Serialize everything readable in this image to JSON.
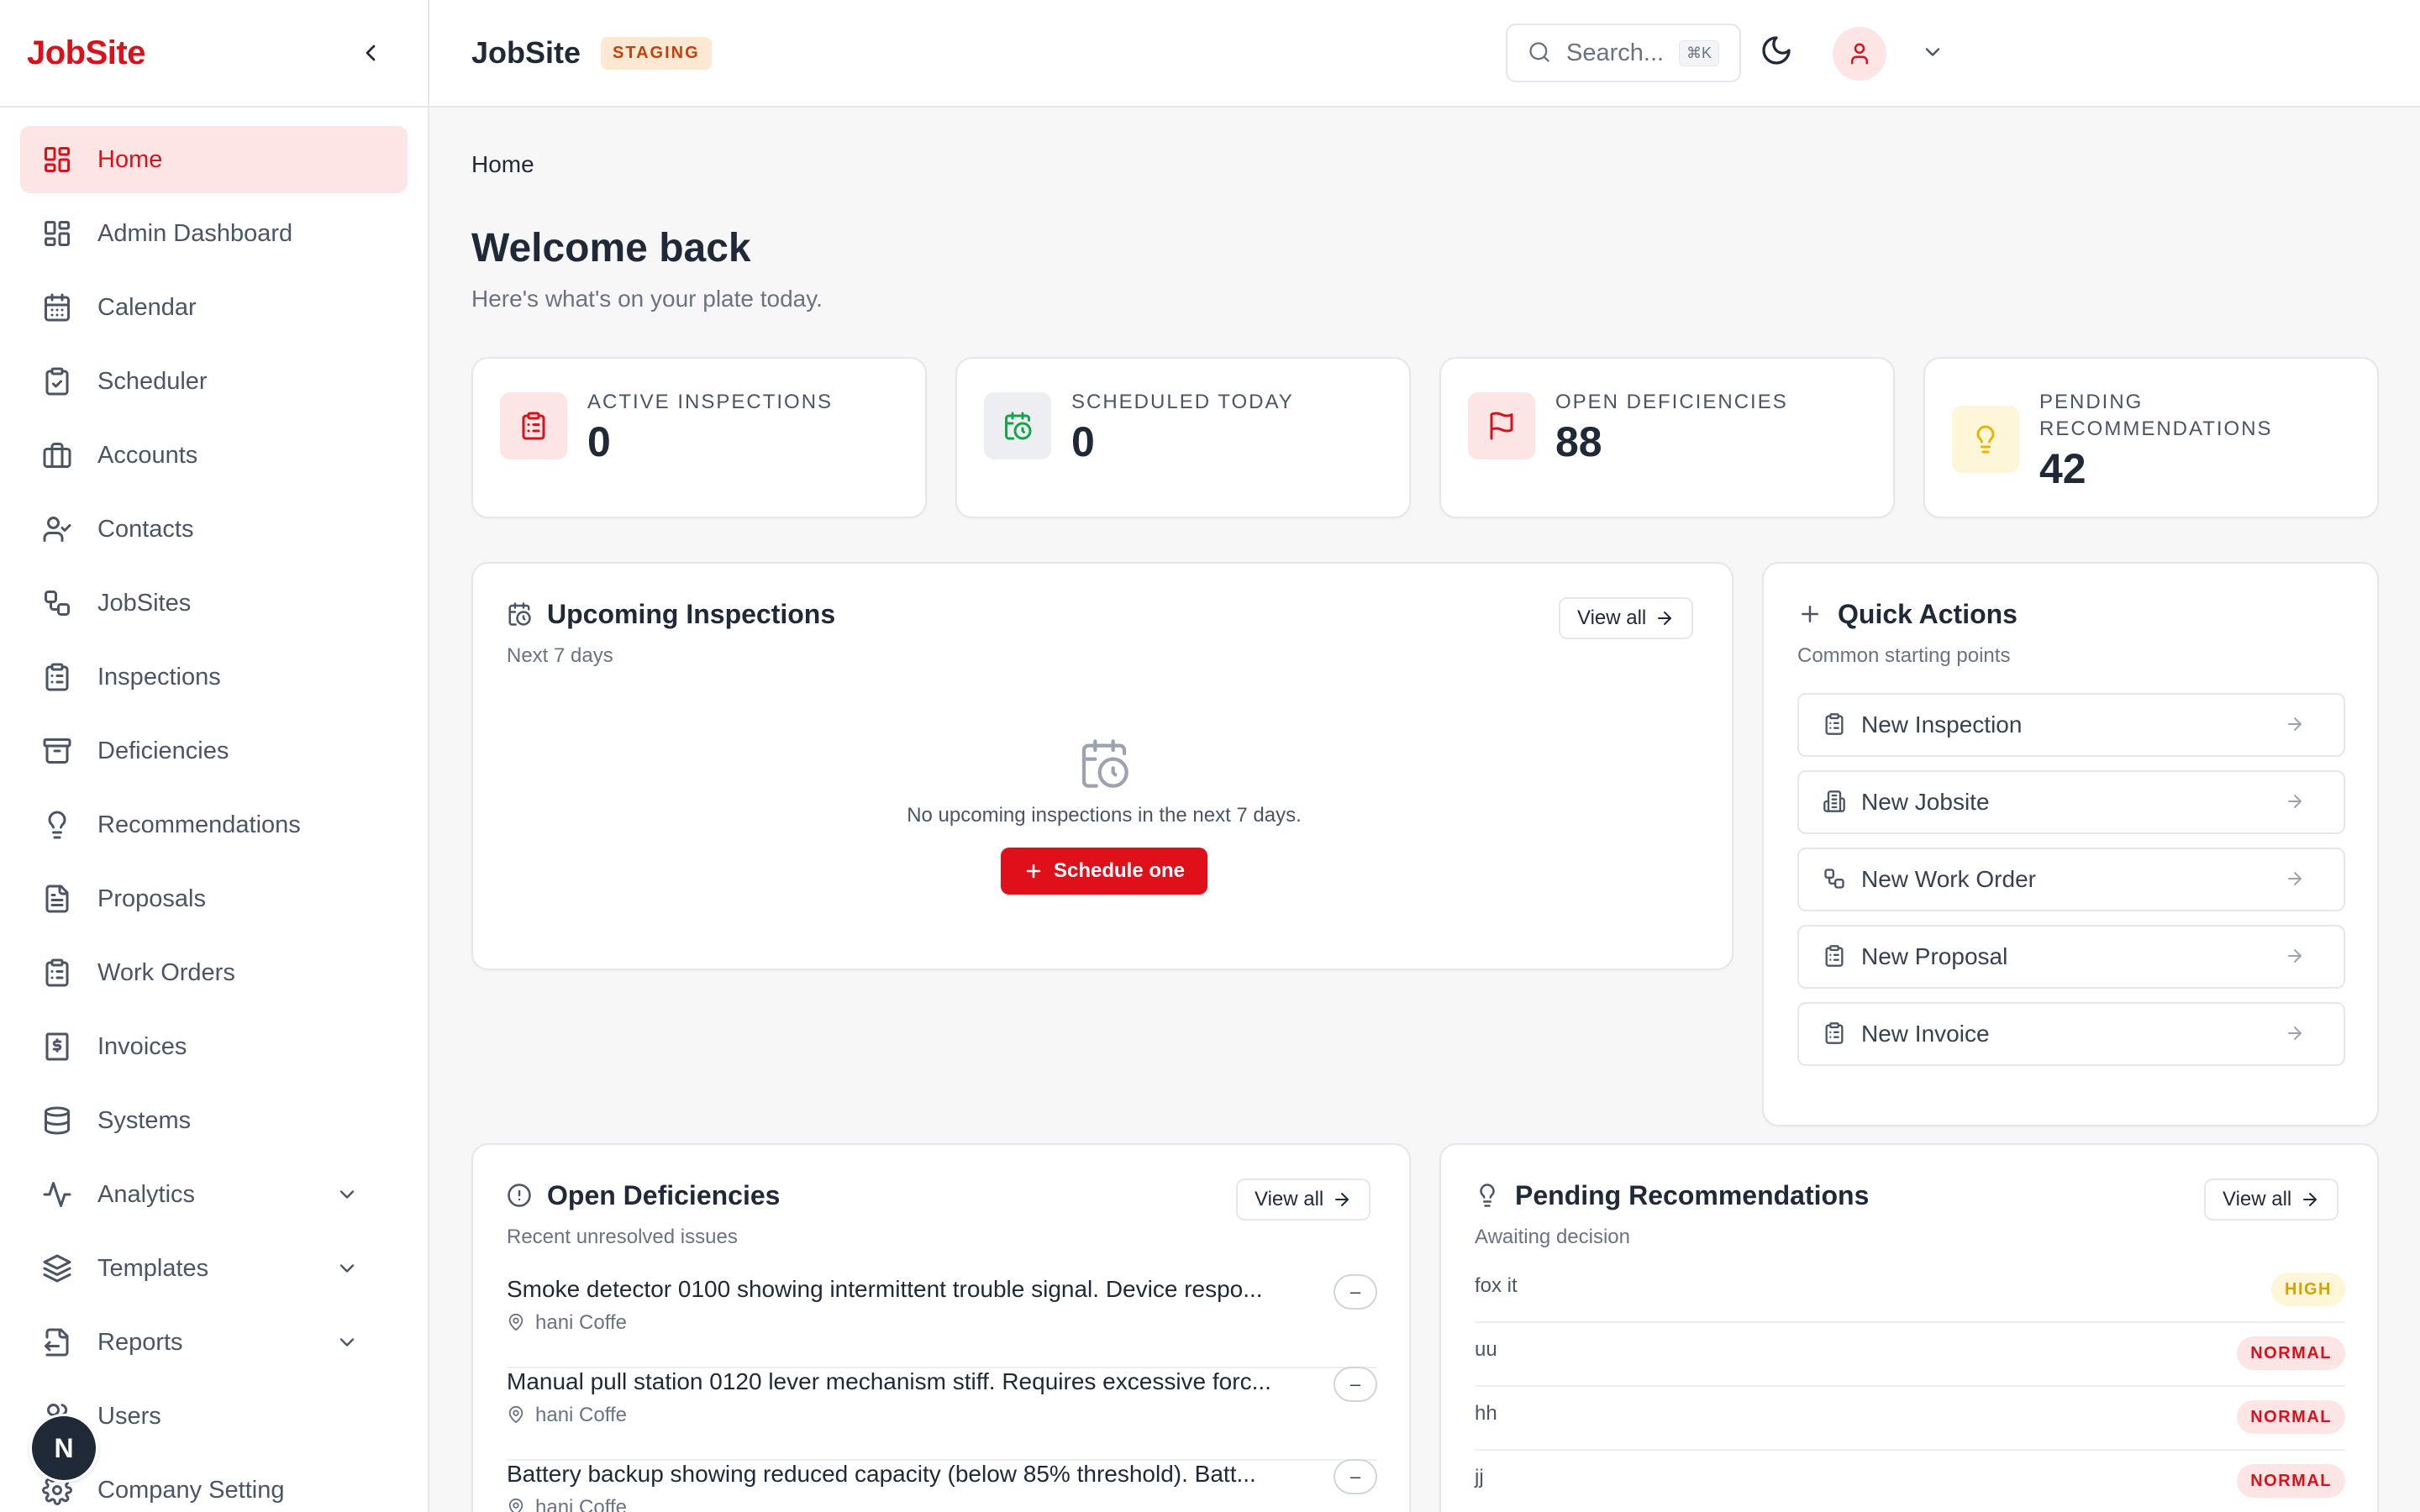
{
  "sidebar": {
    "brand": "JobSite",
    "items": [
      {
        "label": "Home",
        "icon": "grid-icon",
        "active": true
      },
      {
        "label": "Admin Dashboard",
        "icon": "grid-icon"
      },
      {
        "label": "Calendar",
        "icon": "calendar-icon"
      },
      {
        "label": "Scheduler",
        "icon": "clipboard-check-icon"
      },
      {
        "label": "Accounts",
        "icon": "briefcase-icon"
      },
      {
        "label": "Contacts",
        "icon": "user-check-icon"
      },
      {
        "label": "JobSites",
        "icon": "workflow-icon"
      },
      {
        "label": "Inspections",
        "icon": "clipboard-list-icon"
      },
      {
        "label": "Deficiencies",
        "icon": "archive-icon"
      },
      {
        "label": "Recommendations",
        "icon": "lightbulb-icon"
      },
      {
        "label": "Proposals",
        "icon": "file-text-icon"
      },
      {
        "label": "Work Orders",
        "icon": "clipboard-list-icon"
      },
      {
        "label": "Invoices",
        "icon": "receipt-dollar-icon"
      },
      {
        "label": "Systems",
        "icon": "database-icon"
      },
      {
        "label": "Analytics",
        "icon": "activity-icon",
        "expandable": true
      },
      {
        "label": "Templates",
        "icon": "layers-icon",
        "expandable": true
      },
      {
        "label": "Reports",
        "icon": "file-export-icon",
        "expandable": true
      },
      {
        "label": "Users",
        "icon": "users-icon"
      },
      {
        "label": "Company Setting",
        "icon": "gear-icon"
      }
    ],
    "floating_badge": "N"
  },
  "topbar": {
    "title": "JobSite",
    "env_badge": "STAGING",
    "search_placeholder": "Search...",
    "search_shortcut": "⌘K"
  },
  "main": {
    "breadcrumb": "Home",
    "heading": "Welcome back",
    "subheading": "Here's what's on your plate today.",
    "stats": [
      {
        "label": "ACTIVE INSPECTIONS",
        "value": "0",
        "color": "#d9111b"
      },
      {
        "label": "SCHEDULED TODAY",
        "value": "0",
        "color": "#16a34a"
      },
      {
        "label": "OPEN DEFICIENCIES",
        "value": "88",
        "color": "#d9111b"
      },
      {
        "label": "PENDING RECOMMENDATIONS",
        "value": "42",
        "color": "#eab308"
      }
    ],
    "upcoming": {
      "title": "Upcoming Inspections",
      "subtitle": "Next 7 days",
      "view_all": "View all",
      "empty_text": "No upcoming inspections in the next 7 days.",
      "cta": "Schedule one"
    },
    "quick_actions": {
      "title": "Quick Actions",
      "subtitle": "Common starting points",
      "items": [
        {
          "label": "New Inspection",
          "icon": "clipboard-icon"
        },
        {
          "label": "New Jobsite",
          "icon": "building-icon"
        },
        {
          "label": "New Work Order",
          "icon": "workflow-icon"
        },
        {
          "label": "New Proposal",
          "icon": "clipboard-icon"
        },
        {
          "label": "New Invoice",
          "icon": "clipboard-icon"
        }
      ]
    },
    "deficiencies": {
      "title": "Open Deficiencies",
      "subtitle": "Recent unresolved issues",
      "view_all": "View all",
      "rows": [
        {
          "text": "Smoke detector 0100 showing intermittent trouble signal. Device respo...",
          "location": "hani Coffe"
        },
        {
          "text": "Manual pull station 0120 lever mechanism stiff. Requires excessive forc...",
          "location": "hani Coffe"
        },
        {
          "text": "Battery backup showing reduced capacity (below 85% threshold). Batt...",
          "location": "hani Coffe"
        }
      ]
    },
    "recommendations": {
      "title": "Pending Recommendations",
      "subtitle": "Awaiting decision",
      "view_all": "View all",
      "rows": [
        {
          "name": "fox it",
          "priority": "HIGH"
        },
        {
          "name": "uu",
          "priority": "NORMAL"
        },
        {
          "name": "hh",
          "priority": "NORMAL"
        },
        {
          "name": "jj",
          "priority": "NORMAL"
        }
      ]
    }
  }
}
